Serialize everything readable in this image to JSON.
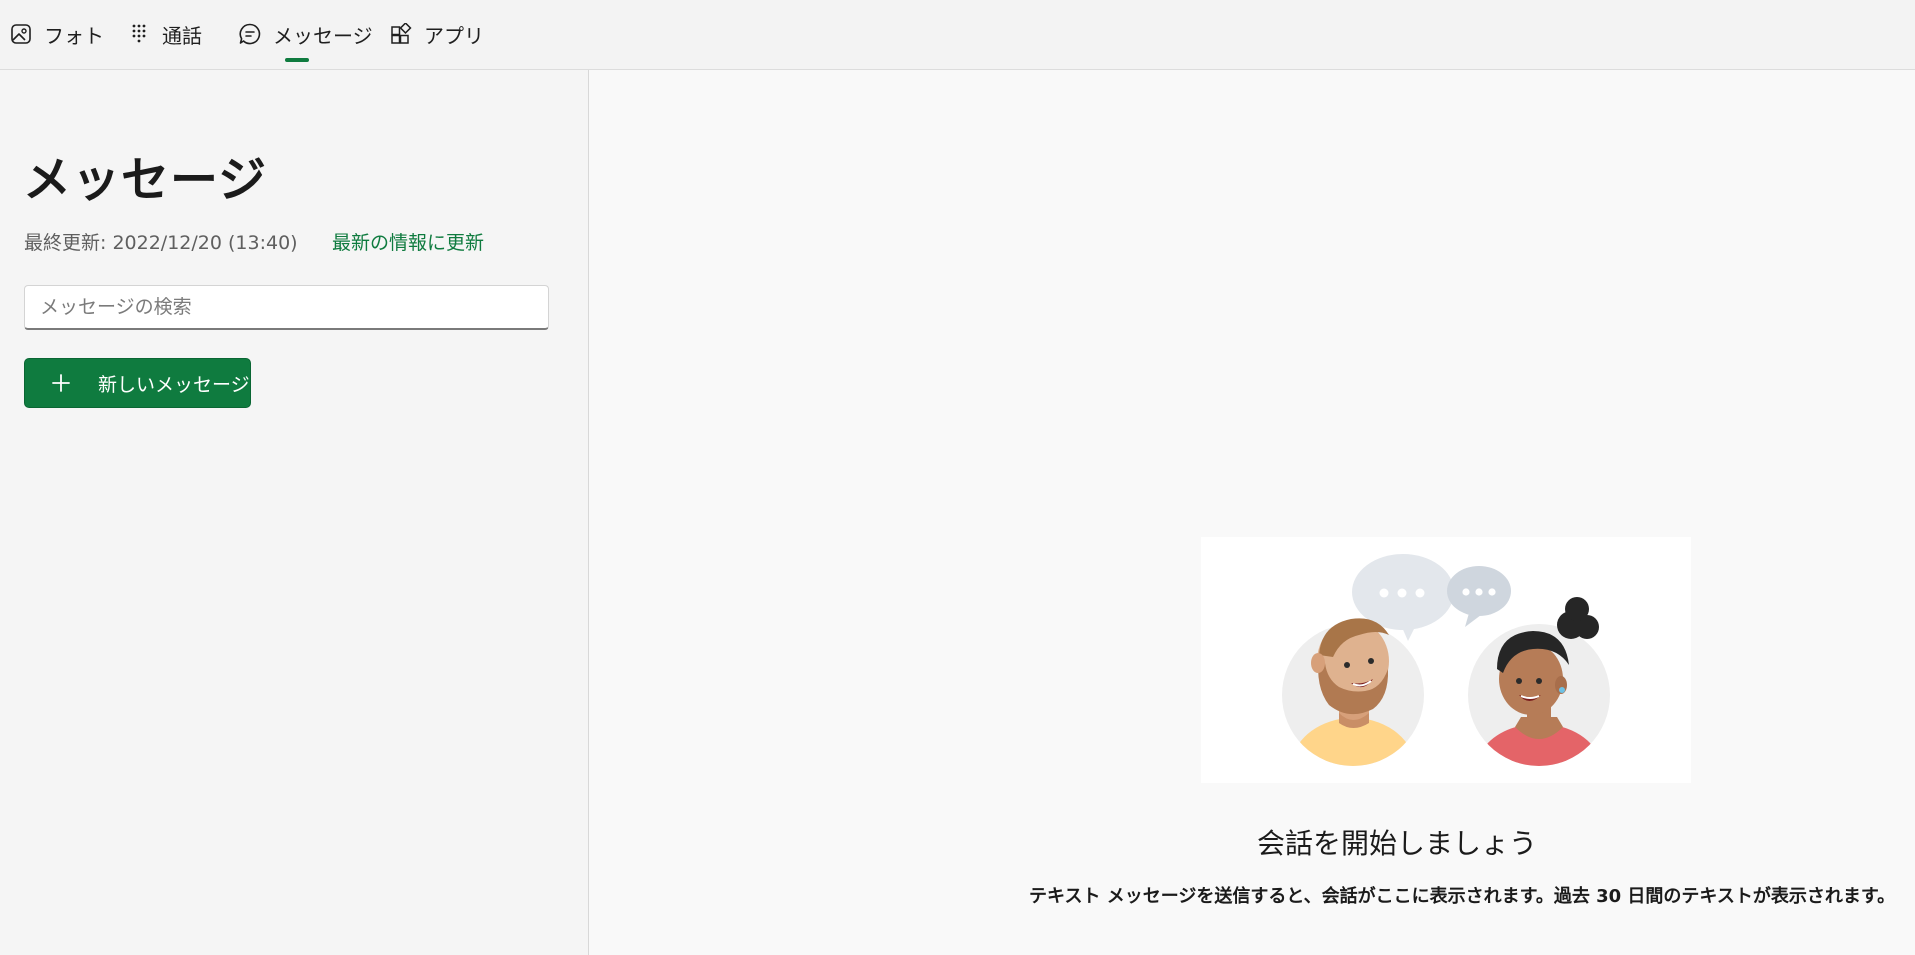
{
  "nav": {
    "tabs": [
      {
        "label": "フォト",
        "icon": "photo-icon"
      },
      {
        "label": "通話",
        "icon": "dialpad-icon"
      },
      {
        "label": "メッセージ",
        "icon": "chat-icon",
        "selected": true
      },
      {
        "label": "アプリ",
        "icon": "apps-icon"
      }
    ]
  },
  "sidebar": {
    "title": "メッセージ",
    "last_updated": "最終更新: 2022/12/20 (13:40)",
    "refresh_label": "最新の情報に更新",
    "search_placeholder": "メッセージの検索",
    "search_value": "",
    "new_message_label": "新しいメッセージ"
  },
  "main": {
    "empty_title": "会話を開始しましょう",
    "empty_description": "テキスト メッセージを送信すると、会話がここに表示されます。過去 30 日間のテキストが表示されます。",
    "illustration": "two-people-chatting-illustration"
  },
  "colors": {
    "accent": "#0f7b3f",
    "topbar_bg": "#f3f3f3",
    "sidebar_bg": "#f5f5f5",
    "main_bg": "#f9f9f9"
  }
}
